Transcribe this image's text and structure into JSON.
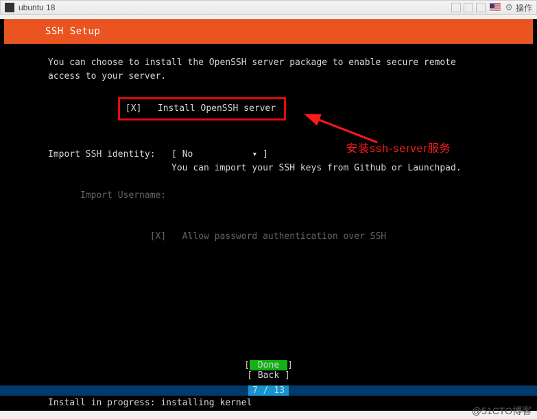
{
  "window": {
    "title": "ubuntu 18",
    "action_label": "操作"
  },
  "header": {
    "title": "SSH Setup"
  },
  "intro": {
    "line1": "You can choose to install the OpenSSH server package to enable secure remote",
    "line2": "access to your server."
  },
  "checkbox": {
    "mark": "[X]",
    "label": "Install OpenSSH server"
  },
  "identity": {
    "label": "Import SSH identity:",
    "bracket_open": "[",
    "value": "No",
    "dropdown_glyph": "▾",
    "bracket_close": "]",
    "hint": "You can import your SSH keys from Github or Launchpad."
  },
  "username": {
    "label": "Import Username:"
  },
  "password_auth": {
    "mark": "[X]",
    "label": "Allow password authentication over SSH"
  },
  "annotation": {
    "text": "安装ssh-server服务"
  },
  "buttons": {
    "done_open": "[",
    "done": " Done      ",
    "done_close": "]",
    "back_open": "[",
    "back": " Back      ",
    "back_close": "]"
  },
  "progress": {
    "label": "7 / 13",
    "percent": 54
  },
  "status": {
    "text": "Install in progress: installing kernel"
  },
  "watermark": "@51CTO博客"
}
